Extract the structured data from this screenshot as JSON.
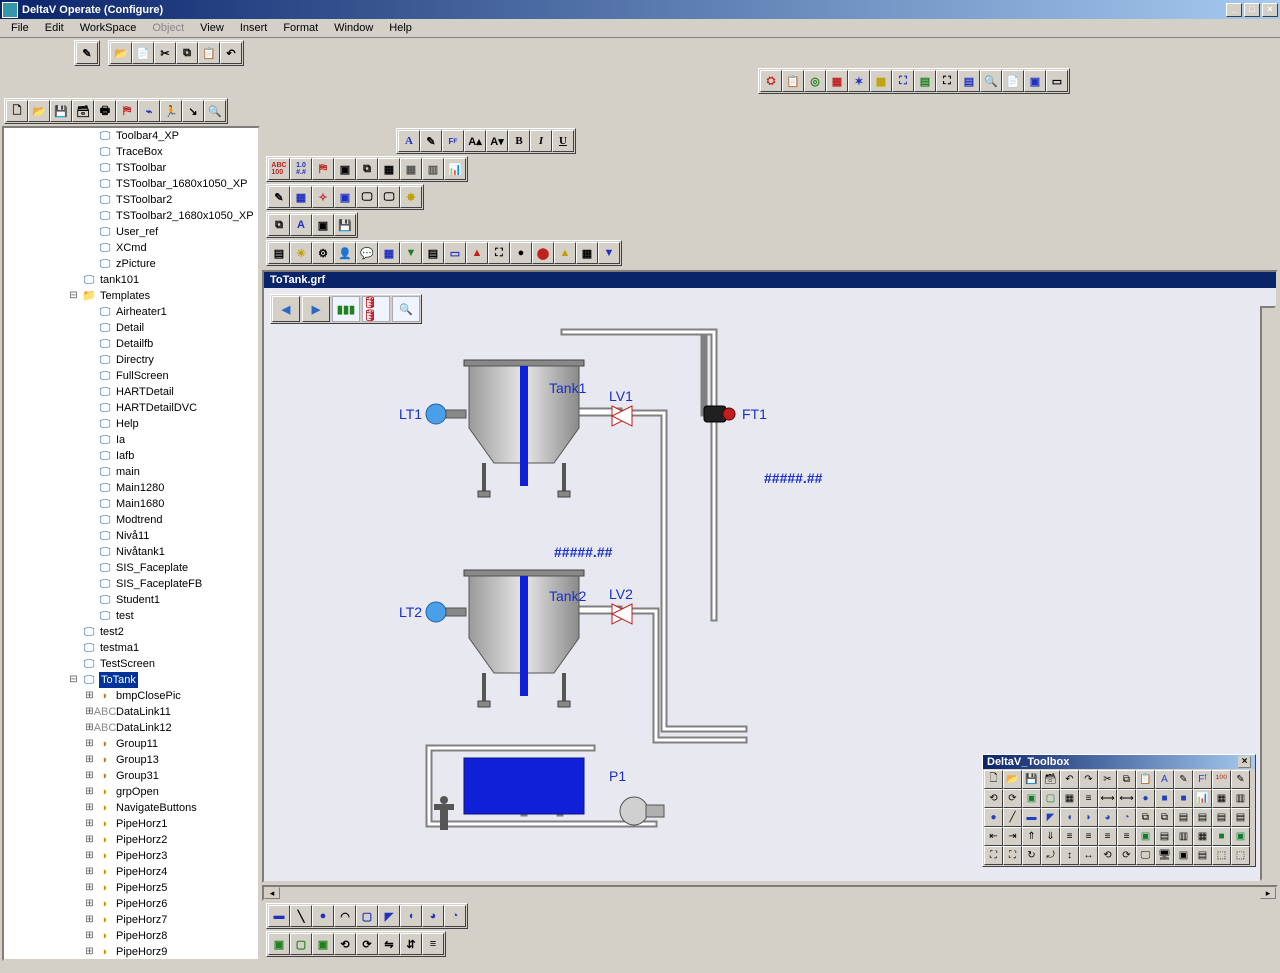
{
  "window": {
    "title": "DeltaV Operate (Configure)"
  },
  "winButtons": {
    "min": "_",
    "max": "□",
    "close": "×"
  },
  "menu": [
    "File",
    "Edit",
    "WorkSpace",
    "Object",
    "View",
    "Insert",
    "Format",
    "Window",
    "Help"
  ],
  "menuDisabled": [
    "Object"
  ],
  "canvas": {
    "title": "ToTank.grf",
    "labels": {
      "tank1": "Tank1",
      "tank2": "Tank2",
      "lt1": "LT1",
      "lt2": "LT2",
      "lv1": "LV1",
      "lv2": "LV2",
      "ft1": "FT1",
      "p1": "P1",
      "num1": "#####.##",
      "num2": "#####.##"
    }
  },
  "palette": {
    "title": "DeltaV_Toolbox"
  },
  "tree": {
    "top": [
      {
        "icon": "screen",
        "label": "Toolbar4_XP"
      },
      {
        "icon": "screen",
        "label": "TraceBox"
      },
      {
        "icon": "screen",
        "label": "TSToolbar"
      },
      {
        "icon": "screen",
        "label": "TSToolbar_1680x1050_XP"
      },
      {
        "icon": "screen",
        "label": "TSToolbar2"
      },
      {
        "icon": "screen",
        "label": "TSToolbar2_1680x1050_XP"
      },
      {
        "icon": "screen",
        "label": "User_ref"
      },
      {
        "icon": "screen",
        "label": "XCmd"
      },
      {
        "icon": "screen",
        "label": "zPicture"
      }
    ],
    "tank101": "tank101",
    "templatesLabel": "Templates",
    "templates": [
      "Airheater1",
      "Detail",
      "Detailfb",
      "Directry",
      "FullScreen",
      "HARTDetail",
      "HARTDetailDVC",
      "Help",
      "Ia",
      "Iafb",
      "main",
      "Main1280",
      "Main1680",
      "Modtrend",
      "Nivå11",
      "Nivåtank1",
      "SIS_Faceplate",
      "SIS_FaceplateFB",
      "Student1",
      "test"
    ],
    "peers": [
      "test2",
      "testma1",
      "TestScreen"
    ],
    "totank": "ToTank",
    "totankChildren": [
      {
        "icon": "grp",
        "label": "bmpClosePic"
      },
      {
        "icon": "link",
        "label": "DataLink11"
      },
      {
        "icon": "link",
        "label": "DataLink12"
      },
      {
        "icon": "grp",
        "label": "Group11"
      },
      {
        "icon": "grp",
        "label": "Group13"
      },
      {
        "icon": "grp",
        "label": "Group31"
      },
      {
        "icon": "shape",
        "label": "grpOpen"
      },
      {
        "icon": "shape",
        "label": "NavigateButtons"
      },
      {
        "icon": "pipe",
        "label": "PipeHorz1"
      },
      {
        "icon": "pipe",
        "label": "PipeHorz2"
      },
      {
        "icon": "pipe",
        "label": "PipeHorz3"
      },
      {
        "icon": "pipe",
        "label": "PipeHorz4"
      },
      {
        "icon": "pipe",
        "label": "PipeHorz5"
      },
      {
        "icon": "pipe",
        "label": "PipeHorz6"
      },
      {
        "icon": "pipe",
        "label": "PipeHorz7"
      },
      {
        "icon": "pipe",
        "label": "PipeHorz8"
      },
      {
        "icon": "pipe",
        "label": "PipeHorz9"
      }
    ]
  }
}
